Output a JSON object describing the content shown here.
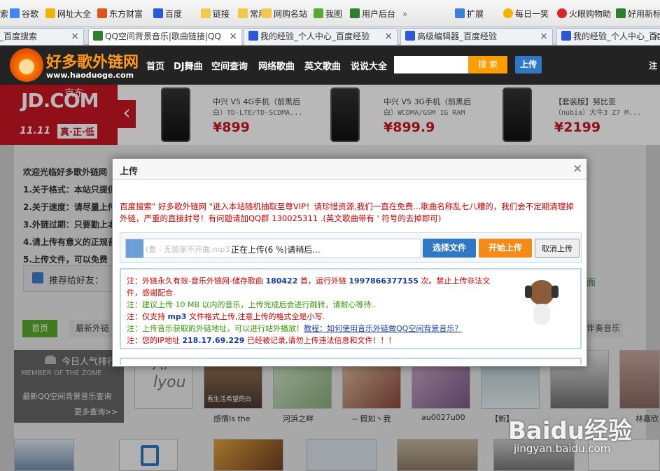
{
  "bookmarks": [
    {
      "label": "谷歌",
      "icon": "google-icon"
    },
    {
      "label": "网址大全",
      "icon": "globe-icon"
    },
    {
      "label": "东方财富",
      "icon": "finance-icon"
    },
    {
      "label": "百度",
      "icon": "baidu-paw-icon"
    },
    {
      "label": "链接",
      "icon": "folder-icon"
    },
    {
      "label": "常用",
      "icon": "folder-icon"
    },
    {
      "label": "网购名站",
      "icon": "folder-icon"
    },
    {
      "label": "我图",
      "icon": "leaf-icon"
    },
    {
      "label": "用户后台",
      "icon": "grid-icon"
    }
  ],
  "bookmarks_more": "»",
  "bookmarks_right": [
    {
      "label": "扩展",
      "icon": "apps-icon"
    },
    {
      "label": "每日一笑",
      "icon": "smile-icon"
    },
    {
      "label": "火眼购物助",
      "icon": "fire-icon"
    },
    {
      "label": "好用新标",
      "icon": "grid-icon"
    }
  ],
  "first_bookmark_fragment": "索",
  "tabs": [
    {
      "label": "_百度搜索",
      "active": false
    },
    {
      "label": "QQ空间背景音乐|歌曲链接|QQ",
      "active": true
    },
    {
      "label": "我的经验_个人中心_百度经验",
      "active": false
    },
    {
      "label": "高级编辑器_百度经验",
      "active": false
    },
    {
      "label": "我的经验_个人中心_百度经验",
      "active": false
    }
  ],
  "tab_close": "×",
  "site": {
    "logo_title": "好多歌外链网",
    "logo_url": "www.haoduoge.com",
    "nav": [
      "首页",
      "DJ舞曲",
      "空间查询",
      "网络歌曲",
      "英文歌曲",
      "说说大全"
    ],
    "search_value": "",
    "search_button": "搜 索",
    "upload_button": "上传",
    "right_fragment": "注"
  },
  "ad": {
    "brand": "JD.COM",
    "brand_cn": "京东",
    "slogan_num": "11.11",
    "slogan": "真·正·低",
    "prev": "‹",
    "products": [
      {
        "name1": "中兴 V5 4G手机（前黑后",
        "name2": "白）TD-LTE/TD-SCDMA...",
        "price": "¥899"
      },
      {
        "name1": "中兴 V5 3G手机（前黑后",
        "name2": "白）WCDMA/GSM 1G RAM",
        "price": "¥899.9"
      },
      {
        "name1": "【套装版】努比亚",
        "name2": "（nubia）大牛3 Z7 M...",
        "price": "¥2199"
      }
    ]
  },
  "welcome": {
    "title": "欢迎光临好多歌外链网",
    "items": [
      "1.关于格式：本站只提供",
      "2.关于速度：请尽量上传",
      "3.外链过期：只要勤上本",
      "4.请上传有意义的正规音",
      "5.上传文件，可以免费"
    ]
  },
  "recommend": "推荐给好友：",
  "recommend_right": "面",
  "tabs_bar": {
    "home": "首页",
    "latest": "最新外链",
    "right": "伴奏音乐"
  },
  "today_hot": {
    "title": "今日人气排行",
    "sub": "MEMBER OF THE ZONE",
    "line": "最新QQ空间背景音乐查询",
    "more": "更多查询>>"
  },
  "thumbs": [
    "感情Is the",
    "河浜之畔",
    "-- 假如丶我",
    "au0027u00",
    "【新】",
    ""
  ],
  "thumb_caption_right": "林嘉欣",
  "thumb_overlay_text": "Ai lyou",
  "thumb_overlay_text2": "看生活希望的白",
  "dialog": {
    "title": "上传",
    "close": "×",
    "warning": "百度搜索\" 好多歌外链网 \"进入本站随机抽取至尊VIP！请珍惜资源,我们一直在免费...歌曲名称乱七八糟的，我们会不定期清理掉外链，严重的直接封号！有问题请加QQ群 130025311 .(英文歌曲带有 ' 符号的去掉即可)",
    "file_hint": "(豊 - 无极家不开曲.mp3",
    "progress_text": "正在上传(6 %)请稍后...",
    "progress_pct": 6,
    "select_btn": "选择文件",
    "start_btn": "开始上传",
    "cancel_btn": "取消上传",
    "notes": [
      {
        "text": "注：外链永久有效-音乐外链网-储存歌曲 ",
        "bold": "180422",
        "text2": " 首，运行外链 ",
        "bold2": "1997866377155",
        "text3": " 次。禁止上传非法文",
        "color": "#cc0000"
      },
      {
        "text": "件，感谢配合.",
        "color": "#cc0000"
      },
      {
        "text": "注：建议上传 10 MB 以内的音乐，上传完成后会进行跳转，请耐心等待..",
        "color": "#339900"
      },
      {
        "text": "注：仅支持 ",
        "bold": "mp3",
        "text2": " 文件格式上传,注意上传的格式全是小写.",
        "color": "#cc0000"
      },
      {
        "text": "注：上传音乐获取的外链地址，可以进行站外播放！",
        "link": "教程：如何使用音乐外链做QQ空间背景音乐？",
        "color": "#339900"
      },
      {
        "text": "注：您的IP地址 ",
        "bold": "218.17.69.229",
        "text2": " 已经被记录,请勿上传违法信息和文件！！！",
        "color": "#cc0000"
      }
    ]
  },
  "watermark": {
    "brand": "Baidu经验",
    "url": "jingyan.baidu.com"
  },
  "colors": {
    "accent_orange": "#ff8a00",
    "blue_btn": "#2f78c6",
    "header_bg": "#232323",
    "jd_red": "#c91623"
  }
}
